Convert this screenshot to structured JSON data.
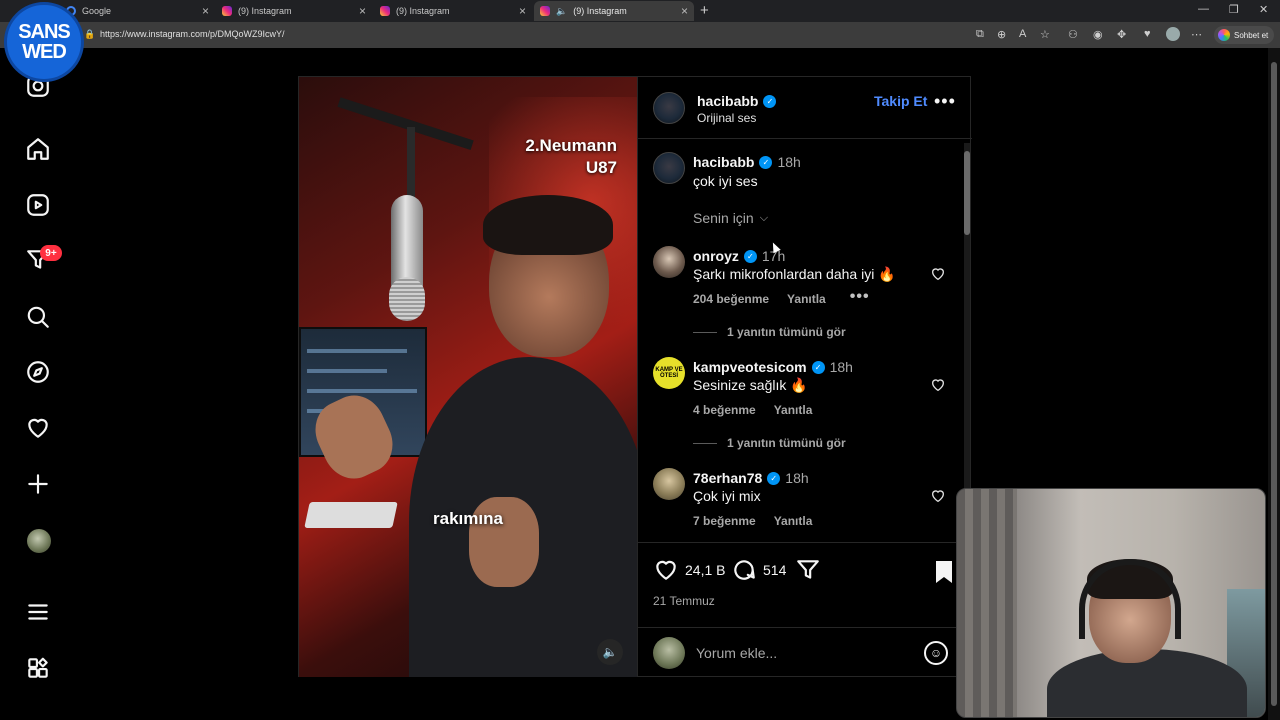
{
  "browser": {
    "tabs": [
      {
        "label": "Google",
        "icon": "google-icon"
      },
      {
        "label": "(9) Instagram",
        "icon": "instagram-icon"
      },
      {
        "label": "(9) Instagram",
        "icon": "instagram-icon"
      },
      {
        "label": "(9) Instagram",
        "icon": "instagram-icon",
        "active": true,
        "audio": true
      }
    ],
    "url": "https://www.instagram.com/p/DMQoWZ9IcwY/",
    "copilot_label": "Sohbet et"
  },
  "channel_logo": {
    "line1": "SANS",
    "line2": "WED"
  },
  "sidebar": {
    "items": [
      {
        "name": "instagram-logo-icon"
      },
      {
        "name": "home-icon"
      },
      {
        "name": "reels-icon"
      },
      {
        "name": "messages-icon",
        "badge": "9+"
      },
      {
        "name": "search-icon"
      },
      {
        "name": "explore-icon"
      },
      {
        "name": "notifications-icon"
      },
      {
        "name": "create-icon"
      },
      {
        "name": "profile-avatar"
      },
      {
        "name": "more-menu-icon"
      },
      {
        "name": "also-from-meta-icon"
      }
    ]
  },
  "video": {
    "overlay_title_line1": "2.Neumann",
    "overlay_title_line2": "U87",
    "caption": "rakımına"
  },
  "post_header": {
    "username": "hacibabb",
    "subtitle": "Orijinal ses",
    "follow_label": "Takip Et",
    "more_label": "•••"
  },
  "caption_comment": {
    "username": "hacibabb",
    "time": "18h",
    "text": "çok iyi ses"
  },
  "filter": {
    "label": "Senin için"
  },
  "comments": [
    {
      "username": "onroyz",
      "time": "17h",
      "text": "Şarkı mikrofonlardan daha iyi 🔥",
      "likes": "204 beğenme",
      "reply": "Yanıtla",
      "more": "•••",
      "view_replies": "1 yanıtın tümünü gör"
    },
    {
      "username": "kampveotesicom",
      "time": "18h",
      "text": "Sesinize sağlık 🔥",
      "likes": "4 beğenme",
      "reply": "Yanıtla",
      "view_replies": "1 yanıtın tümünü gör",
      "avatar_text": "KAMP VE ÖTESİ"
    },
    {
      "username": "78erhan78",
      "time": "18h",
      "text": "Çok iyi mix",
      "likes": "7 beğenme",
      "reply": "Yanıtla"
    }
  ],
  "actions": {
    "likes": "24,1 B",
    "comments": "514",
    "date": "21 Temmuz"
  },
  "comment_box": {
    "placeholder": "Yorum ekle..."
  },
  "colors": {
    "accent": "#4f8bff",
    "verified": "#0095f6",
    "badge": "#ff3040",
    "logo": "#1565d8"
  }
}
